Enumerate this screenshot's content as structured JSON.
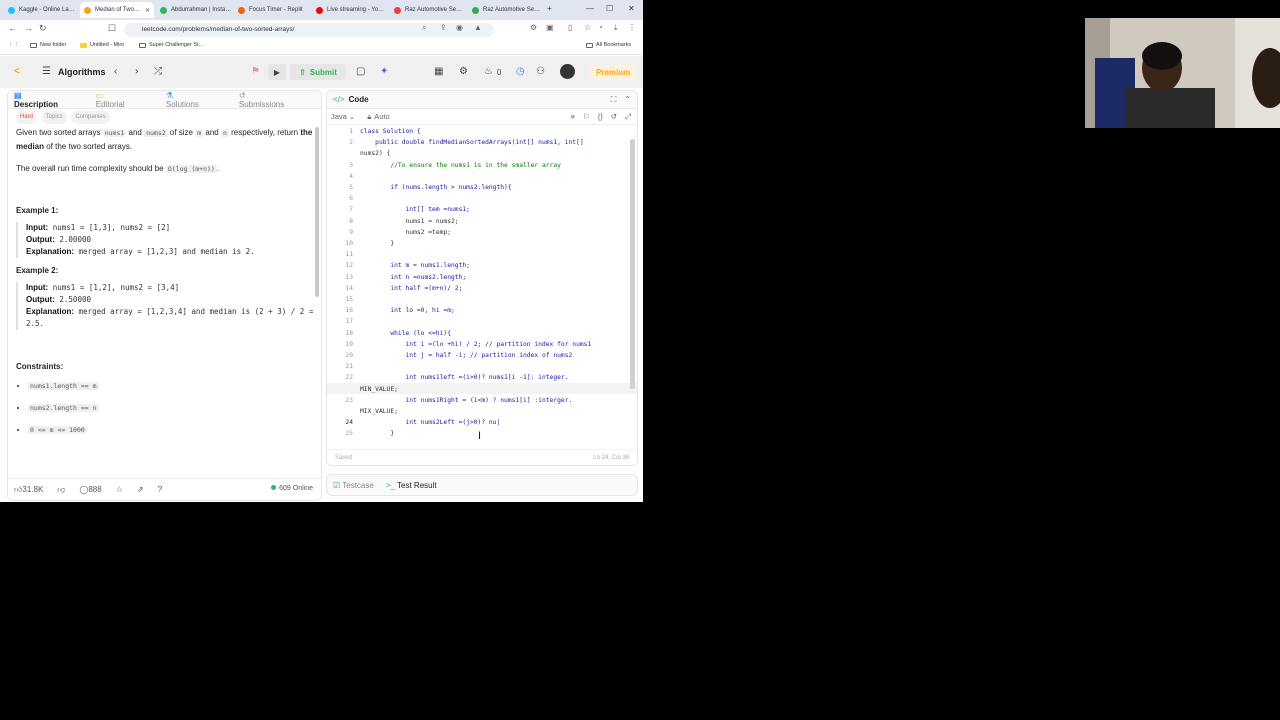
{
  "browser": {
    "tabs": [
      {
        "label": "Kaggle - Online La…",
        "color": "#20beff",
        "active": false
      },
      {
        "label": "Median of Two…",
        "color": "#ffa116",
        "active": true
      },
      {
        "label": "Abdurrahman | Insta…",
        "color": "#2db55d",
        "active": false
      },
      {
        "label": "Focus Timer - Replit",
        "color": "#f26207",
        "active": false
      },
      {
        "label": "Live streaming - Yo…",
        "color": "#ff0000",
        "active": false
      },
      {
        "label": "Raz Automotive Se…",
        "color": "#ea4335",
        "active": false
      },
      {
        "label": "Raz Automotive Se…",
        "color": "#34a853",
        "active": false
      }
    ],
    "url": "leetcode.com/problems/median-of-two-sorted-arrays/",
    "bookmarks": [
      "New folder",
      "Untitled - Miro",
      "Super Challenger St…"
    ],
    "all_bookmarks": "All Bookmarks"
  },
  "header": {
    "title": "Algorithms",
    "submit_label": "Submit",
    "streak_count": "0",
    "premium_label": "Premium"
  },
  "left_tabs": {
    "description": "Description",
    "editorial": "Editorial",
    "solutions": "Solutions",
    "submissions": "Submissions"
  },
  "problem": {
    "tags": [
      "Hard",
      "Topics",
      "Companies"
    ],
    "intro_a": "Given two sorted arrays ",
    "nums1": "nums1",
    "intro_and": " and ",
    "nums2": "nums2",
    "intro_size": " of size ",
    "m": "m",
    "n": "n",
    "intro_resp": " respectively, return ",
    "median_bold": "the median",
    "intro_end": " of the two sorted arrays.",
    "complexity_a": "The overall run time complexity should be ",
    "complexity_code": "O(log (m+n))",
    "complexity_end": ".",
    "example1_title": "Example 1:",
    "example1_input": "nums1 = [1,3], nums2 = [2]",
    "example1_output": "2.00000",
    "example1_expl": "merged array = [1,2,3] and median is 2.",
    "example2_title": "Example 2:",
    "example2_input": "nums1 = [1,2], nums2 = [3,4]",
    "example2_output": "2.50000",
    "example2_expl": "merged array = [1,2,3,4] and median is (2 + 3) / 2 = 2.5.",
    "input_label": "Input:",
    "output_label": "Output:",
    "expl_label": "Explanation:",
    "constraints_title": "Constraints:",
    "constraints": [
      "nums1.length == m",
      "nums2.length == n",
      "0 <= m <= 1000"
    ]
  },
  "left_footer": {
    "likes": "31.8K",
    "comments": "888",
    "online": "609 Online"
  },
  "code_panel": {
    "title": "Code",
    "language": "Java",
    "mode": "Auto",
    "status_saved": "Saved",
    "cursor_pos": "Ln 24, Col 38",
    "lines": [
      {
        "n": "1",
        "text": "class Solution {"
      },
      {
        "n": "2",
        "text": "    public double findMedianSortedArrays(int[] nums1, int[]"
      },
      {
        "n": "",
        "text": "nums2) {"
      },
      {
        "n": "3",
        "text": "        //To ensure the nums1 is in the smaller array"
      },
      {
        "n": "4",
        "text": ""
      },
      {
        "n": "5",
        "text": "        if (nums.length > nums2.length){"
      },
      {
        "n": "6",
        "text": ""
      },
      {
        "n": "7",
        "text": "            int[] tem =nums1;"
      },
      {
        "n": "8",
        "text": "            nums1 = nums2;"
      },
      {
        "n": "9",
        "text": "            nums2 =temp;"
      },
      {
        "n": "10",
        "text": "        }"
      },
      {
        "n": "11",
        "text": ""
      },
      {
        "n": "12",
        "text": "        int m = nums1.length;"
      },
      {
        "n": "13",
        "text": "        int n =nums2.length;"
      },
      {
        "n": "14",
        "text": "        int half =(m+n)/ 2;"
      },
      {
        "n": "15",
        "text": ""
      },
      {
        "n": "16",
        "text": "        int lo =0, hi =m;"
      },
      {
        "n": "17",
        "text": ""
      },
      {
        "n": "18",
        "text": "        while (lo <=hi){"
      },
      {
        "n": "19",
        "text": "            int i =(lo +hi) / 2; // partition index for nums1"
      },
      {
        "n": "20",
        "text": "            int j = half -i; // partition index of nums2"
      },
      {
        "n": "21",
        "text": ""
      },
      {
        "n": "22",
        "text": "            int nums1left =(i>0)? nums1[i -1]: integer."
      },
      {
        "n": "",
        "text": "MIN_VALUE;"
      },
      {
        "n": "23",
        "text": "            int nums1Right = (i<m) ? nums1[i] :interger."
      },
      {
        "n": "",
        "text": "MIX_VALUE;"
      },
      {
        "n": "24",
        "text": "            int nums2Left =(j>0)? nu|"
      },
      {
        "n": "25",
        "text": "        }"
      }
    ]
  },
  "bottom_tabs": {
    "testcase": "Testcase",
    "test_result": "Test Result"
  }
}
